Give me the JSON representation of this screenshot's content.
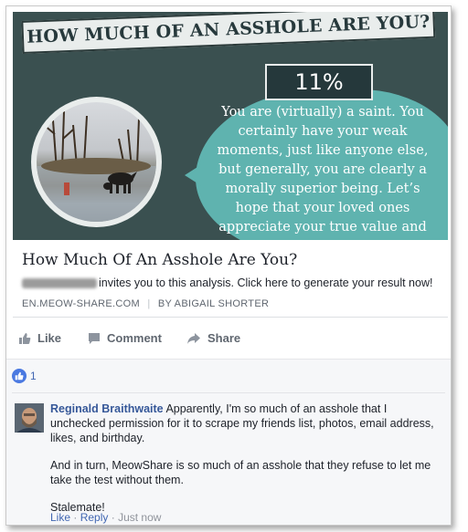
{
  "banner": {
    "title": "HOW MUCH OF AN ASSHOLE ARE  YOU?",
    "percent": "11%",
    "verdict": "You are (virtually) a saint. You certainly have your weak moments, just like anyone else, but generally, you are clearly a morally superior being. Let’s hope that your loved ones appreciate your true value and don’t abuse your kindness.",
    "colors": {
      "background": "#3a5050",
      "bubble": "#5fb3af"
    }
  },
  "card": {
    "title": "How Much Of An Asshole Are You?",
    "description": "invites you to this analysis. Click here to generate your result now!",
    "domain": "EN.MEOW-SHARE.COM",
    "separator": "|",
    "byline": "BY ABIGAIL SHORTER"
  },
  "actions": {
    "like": "Like",
    "comment": "Comment",
    "share": "Share"
  },
  "reactions": {
    "count": "1",
    "icon": "thumbs-up-icon"
  },
  "comment": {
    "author": "Reginald Braithwaite",
    "paragraph1": "Apparently, I'm so much of an asshole that I unchecked permission for it to scrape my friends list, photos, email address, likes, and birthday.",
    "paragraph2": "And in turn, MeowShare is so much of an asshole that they refuse to let me take the test without them.",
    "paragraph3": "Stalemate!",
    "like": "Like",
    "reply": "Reply",
    "dot": "·",
    "time": "Just now"
  }
}
